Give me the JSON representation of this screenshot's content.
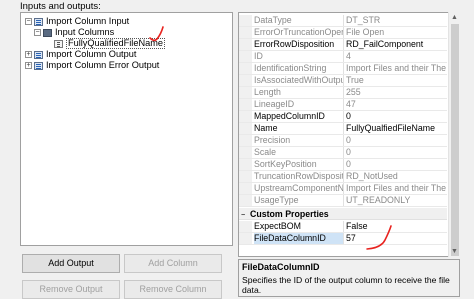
{
  "section_label": "Inputs and outputs:",
  "tree": {
    "import_input": "Import Column Input",
    "input_columns": "Input Columns",
    "selected_column": "FullyQualifiedFileName",
    "import_output": "Import Column Output",
    "import_error_output": "Import Column Error Output"
  },
  "buttons": {
    "add_output": "Add Output",
    "add_column": "Add Column",
    "remove_output": "Remove Output",
    "remove_column": "Remove Column"
  },
  "properties": [
    {
      "name": "DataType",
      "value": "DT_STR"
    },
    {
      "name": "ErrorOrTruncationOperati",
      "value": "File Open"
    },
    {
      "name": "ErrorRowDisposition",
      "value": "RD_FailComponent"
    },
    {
      "name": "ID",
      "value": "4"
    },
    {
      "name": "IdentificationString",
      "value": "Import Files and their Their Na"
    },
    {
      "name": "IsAssociatedWithOutputC",
      "value": "True"
    },
    {
      "name": "Length",
      "value": "255"
    },
    {
      "name": "LineageID",
      "value": "47"
    },
    {
      "name": "MappedColumnID",
      "value": "0"
    },
    {
      "name": "Name",
      "value": "FullyQualfiedFileName"
    },
    {
      "name": "Precision",
      "value": "0"
    },
    {
      "name": "Scale",
      "value": "0"
    },
    {
      "name": "SortKeyPosition",
      "value": "0"
    },
    {
      "name": "TruncationRowDispositio",
      "value": "RD_NotUsed"
    },
    {
      "name": "UpstreamComponentNam",
      "value": "Import Files and their Their Na"
    },
    {
      "name": "UsageType",
      "value": "UT_READONLY"
    }
  ],
  "custom_category": "Custom Properties",
  "custom_properties": [
    {
      "name": "ExpectBOM",
      "value": "False"
    },
    {
      "name": "FileDataColumnID",
      "value": "57"
    }
  ],
  "description": {
    "title": "FileDataColumnID",
    "text": "Specifies the ID of the output column to receive the file data."
  },
  "colors": {
    "annotation_red": "#e8231f",
    "selection": "#cfe3f6"
  }
}
